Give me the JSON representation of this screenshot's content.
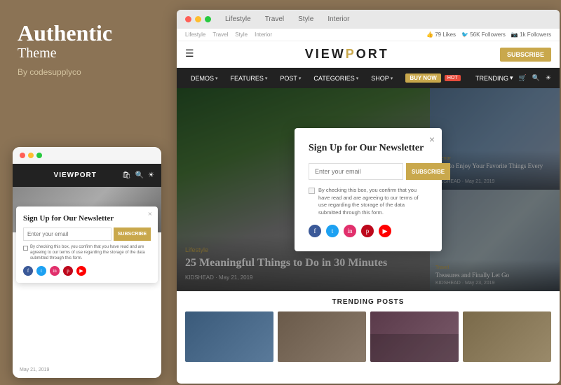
{
  "brand": {
    "title": "Authentic",
    "subtitle": "Theme",
    "by": "By codesupplyco"
  },
  "browser": {
    "tabs": [
      "Lifestyle",
      "Travel",
      "Style",
      "Interior"
    ]
  },
  "site": {
    "top_links": [
      "Lifestyle",
      "Travel",
      "Style",
      "Interior"
    ],
    "social": [
      {
        "icon": "fb",
        "label": "79 Likes"
      },
      {
        "icon": "tw",
        "label": "56K Followers"
      },
      {
        "icon": "ig",
        "label": "1k Followers"
      }
    ],
    "logo": "VIEWPORT",
    "subscribe_label": "SUBSCRIBE",
    "nav": {
      "items": [
        {
          "label": "DEMOS",
          "has_dropdown": true
        },
        {
          "label": "FEATURES",
          "has_dropdown": true
        },
        {
          "label": "POST",
          "has_dropdown": true
        },
        {
          "label": "CATEGORIES",
          "has_dropdown": true
        },
        {
          "label": "SHOP",
          "has_dropdown": true
        },
        {
          "label": "BUY NOW",
          "has_badge": true,
          "badge": "HOT"
        }
      ],
      "right": [
        {
          "label": "TRENDING",
          "has_dropdown": true
        },
        {
          "label": "🛒"
        },
        {
          "label": "🔍"
        },
        {
          "label": "☀"
        }
      ]
    }
  },
  "hero": {
    "category": "Lifestyle",
    "title": "25 Meaningful Things to Do in 30 Minutes",
    "meta": "KIDSHEAD · May 21, 2019"
  },
  "article_top": {
    "category": "Interior",
    "title": "How to Enjoy Your Favorite Things Every Day",
    "meta": "KIDSHEAD · May 21, 2019"
  },
  "article_bottom": {
    "category": "Travel",
    "title": "Treasures and Finally Let Go",
    "meta": "KIDSHEAD · May 23, 2019"
  },
  "newsletter": {
    "title": "Sign Up for Our Newsletter",
    "email_placeholder": "Enter your email",
    "subscribe_label": "SUBSCRIBE",
    "checkbox_text": "By checking this box, you confirm that you have read and are agreeing to our terms of use regarding the storage of the data submitted through this form.",
    "close_icon": "×",
    "social": [
      "f",
      "t",
      "in",
      "p",
      "▶"
    ]
  },
  "trending": {
    "title": "TRENDING POSTS",
    "posts": [
      {
        "id": 1,
        "class": "tp1"
      },
      {
        "id": 2,
        "class": "tp2"
      },
      {
        "id": 3,
        "class": "tp3"
      },
      {
        "id": 4,
        "class": "tp4"
      }
    ]
  },
  "mobile": {
    "newsletter_title": "Sign Up for Our Newsletter",
    "email_placeholder": "Enter your email",
    "subscribe_label": "SUBSCRIBE",
    "checkbox_text": "By checking this box, you confirm that you have read and are agreeing to our terms of use regarding the storage of the data submitted through this form.",
    "date": "May 21, 2019"
  }
}
